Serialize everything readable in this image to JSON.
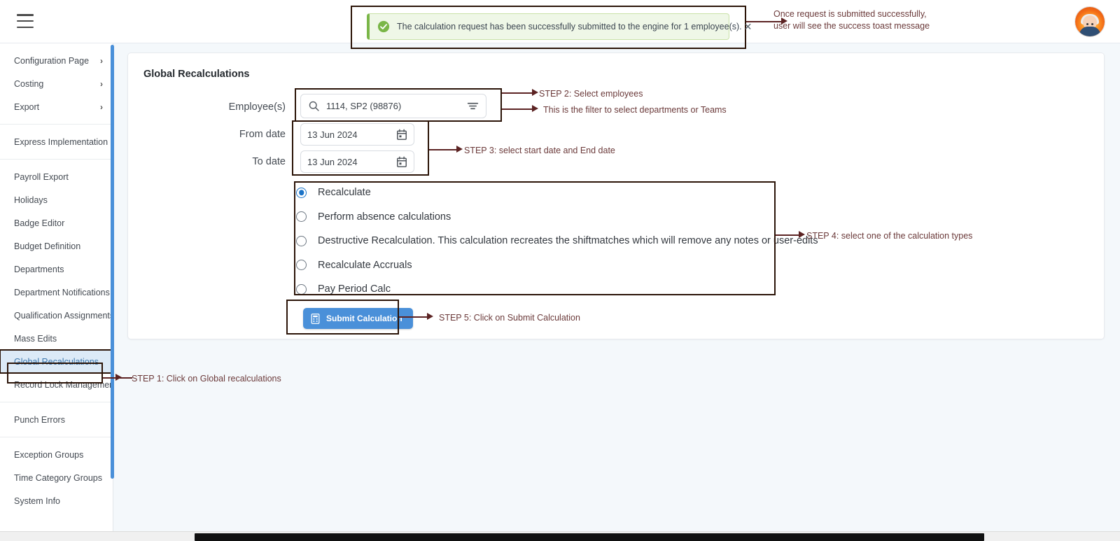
{
  "topbar": {
    "menu_icon": "hamburger-icon",
    "avatar_alt": "user-avatar"
  },
  "sidebar": {
    "groups": [
      {
        "items": [
          {
            "label": "Configuration Page",
            "has_chevron": true,
            "active": false
          },
          {
            "label": "Costing",
            "has_chevron": true,
            "active": false
          },
          {
            "label": "Export",
            "has_chevron": true,
            "active": false
          }
        ]
      },
      {
        "items": [
          {
            "label": "Express Implementation P...",
            "has_chevron": false,
            "active": false
          }
        ]
      },
      {
        "items": [
          {
            "label": "Payroll Export",
            "has_chevron": false,
            "active": false
          },
          {
            "label": "Holidays",
            "has_chevron": false,
            "active": false
          },
          {
            "label": "Badge Editor",
            "has_chevron": false,
            "active": false
          },
          {
            "label": "Budget Definition",
            "has_chevron": false,
            "active": false
          },
          {
            "label": "Departments",
            "has_chevron": false,
            "active": false
          },
          {
            "label": "Department Notifications",
            "has_chevron": false,
            "active": false
          },
          {
            "label": "Qualification Assignments",
            "has_chevron": false,
            "active": false
          },
          {
            "label": "Mass Edits",
            "has_chevron": false,
            "active": false
          },
          {
            "label": "Global Recalculations",
            "has_chevron": false,
            "active": true
          },
          {
            "label": "Record Lock Management",
            "has_chevron": false,
            "active": false
          }
        ]
      },
      {
        "items": [
          {
            "label": "Punch Errors",
            "has_chevron": false,
            "active": false
          }
        ]
      },
      {
        "items": [
          {
            "label": "Exception Groups",
            "has_chevron": false,
            "active": false
          },
          {
            "label": "Time Category Groups",
            "has_chevron": false,
            "active": false
          },
          {
            "label": "System Info",
            "has_chevron": false,
            "active": false
          }
        ]
      }
    ]
  },
  "toast": {
    "message": "The calculation request has been successfully submitted to the engine for 1 employee(s).",
    "close_label": "✕",
    "icon": "check-circle-icon",
    "bg_color": "#eff7e7",
    "accent_color": "#7ab648"
  },
  "page": {
    "title": "Global Recalculations"
  },
  "form": {
    "employee_label": "Employee(s)",
    "employee_value": "1114, SP2 (98876)",
    "employee_search_icon": "search-icon",
    "employee_filter_icon": "filter-icon",
    "from_date_label": "From date",
    "from_date_value": "13 Jun 2024",
    "to_date_label": "To date",
    "to_date_value": "13 Jun 2024",
    "calendar_icon": "calendar-icon",
    "calculation_types": [
      {
        "label": "Recalculate",
        "selected": true
      },
      {
        "label": "Perform absence calculations",
        "selected": false
      },
      {
        "label": "Destructive Recalculation. This calculation recreates the shiftmatches which will remove any notes or user-edits",
        "selected": false
      },
      {
        "label": "Recalculate Accruals",
        "selected": false
      },
      {
        "label": "Pay Period Calc",
        "selected": false
      }
    ],
    "submit_label": "Submit Calculation",
    "submit_icon": "calculator-icon",
    "submit_color": "#4a90d9"
  },
  "annotations": {
    "toast_note_line1": "Once request is submitted successfully,",
    "toast_note_line2": "user will see the success toast message",
    "step1": "STEP 1: Click on Global recalculations",
    "step2": "STEP 2: Select employees",
    "step2b": "This is the filter to select departments or Teams",
    "step3": "STEP 3: select start date and End date",
    "step4": "STEP 4: select one of the calculation types",
    "step5": "STEP 5: Click on Submit Calculation",
    "color": "#6b3a3a"
  }
}
